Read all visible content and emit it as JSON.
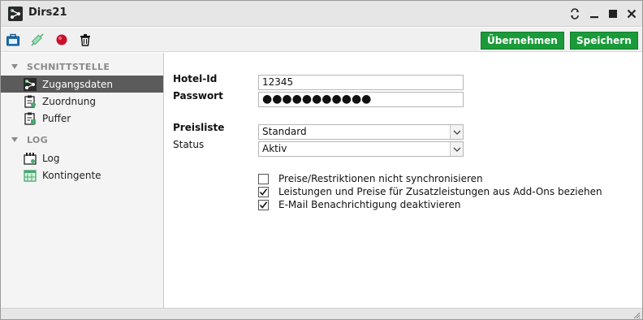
{
  "window": {
    "title": "Dirs21",
    "controls": [
      "refresh-icon",
      "minimize-icon",
      "maximize-icon",
      "close-icon"
    ]
  },
  "toolbar": {
    "icons": [
      "briefcase-icon",
      "syringe-icon",
      "record-icon",
      "trash-icon"
    ],
    "apply_label": "Übernehmen",
    "save_label": "Speichern",
    "accent": "#1b9a3a"
  },
  "sidebar": {
    "sections": [
      {
        "header": "SCHNITTSTELLE",
        "items": [
          {
            "label": "Zugangsdaten",
            "icon": "network-icon",
            "active": true
          },
          {
            "label": "Zuordnung",
            "icon": "clipboard-list-icon",
            "active": false
          },
          {
            "label": "Puffer",
            "icon": "clipboard-buffer-icon",
            "active": false
          }
        ]
      },
      {
        "header": "LOG",
        "items": [
          {
            "label": "Log",
            "icon": "log-icon",
            "active": false
          },
          {
            "label": "Kontingente",
            "icon": "calendar-icon",
            "active": false
          }
        ]
      }
    ]
  },
  "form": {
    "hotel_id_label": "Hotel-Id",
    "hotel_id_value": "12345",
    "password_label": "Passwort",
    "password_value": "●●●●●●●●●●●",
    "pricelist_label": "Preisliste",
    "pricelist_value": "Standard",
    "status_label": "Status",
    "status_value": "Aktiv",
    "checkboxes": [
      {
        "label": "Preise/Restriktionen nicht synchronisieren",
        "checked": false
      },
      {
        "label": "Leistungen und Preise für Zusatzleistungen aus Add-Ons beziehen",
        "checked": true
      },
      {
        "label": "E-Mail Benachrichtigung deaktivieren",
        "checked": true
      }
    ]
  }
}
